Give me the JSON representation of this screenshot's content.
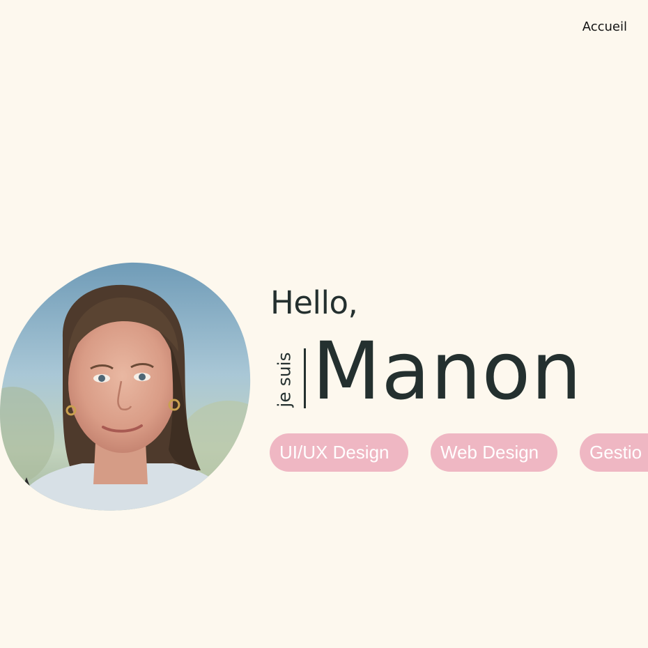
{
  "nav": {
    "home_label": "Accueil"
  },
  "hero": {
    "greeting": "Hello,",
    "intro": "je suis",
    "name": "Manon",
    "portrait_alt": "Portrait of Manon"
  },
  "skills": [
    {
      "label": "UI/UX Design"
    },
    {
      "label": "Web Design"
    },
    {
      "label": "Gestio"
    }
  ],
  "colors": {
    "background": "#fdf8ee",
    "text": "#24302f",
    "pill": "#efb7c3",
    "pill_text": "#ffffff"
  }
}
